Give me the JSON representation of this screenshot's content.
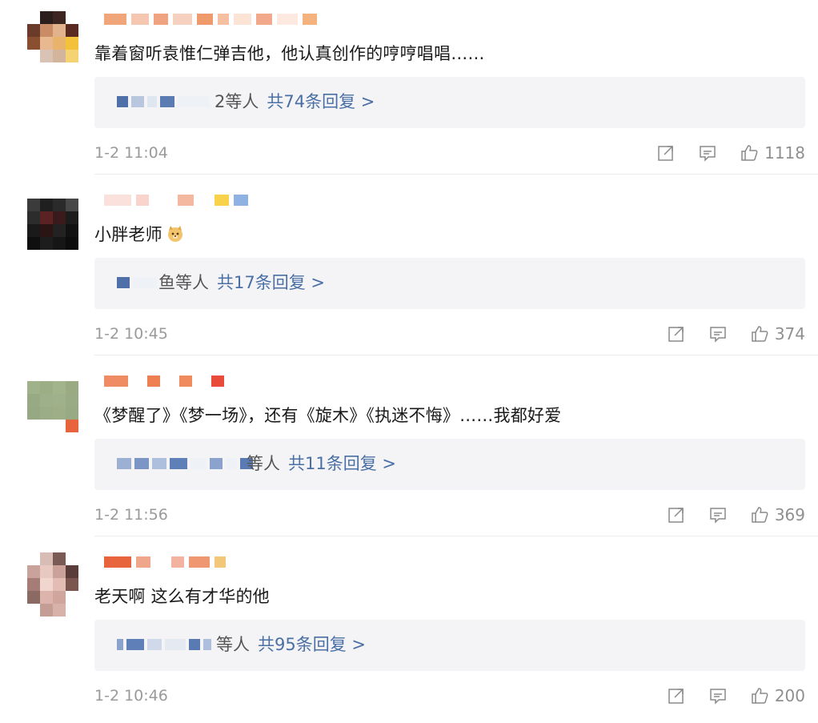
{
  "comments": [
    {
      "text": "靠着窗听袁惟仁弹吉他，他认真创作的哼哼唱唱……",
      "reply_prefix": "2等人",
      "reply_link": "共74条回复 >",
      "timestamp": "1-2 11:04",
      "likes": "1118"
    },
    {
      "text": "小胖老师",
      "reply_prefix": "鱼等人",
      "reply_link": "共17条回复 >",
      "timestamp": "1-2 10:45",
      "likes": "374"
    },
    {
      "text": "《梦醒了》《梦一场》，还有《旋木》《执迷不悔》……我都好爱",
      "reply_prefix": "等人",
      "reply_link": "共11条回复 >",
      "timestamp": "1-2 11:56",
      "likes": "369"
    },
    {
      "text": "老天啊 这么有才华的他",
      "reply_prefix": "等人",
      "reply_link": "共95条回复 >",
      "timestamp": "1-2 10:46",
      "likes": "200"
    }
  ],
  "icons": {
    "share": "share-icon",
    "reply": "comment-icon",
    "like": "thumbs-up-icon",
    "emoji": "dog-emoji-icon"
  },
  "colors": {
    "reply_link": "#4a6fa5",
    "meta_text": "#9a9a9a",
    "reply_box": "#f4f4f6"
  }
}
